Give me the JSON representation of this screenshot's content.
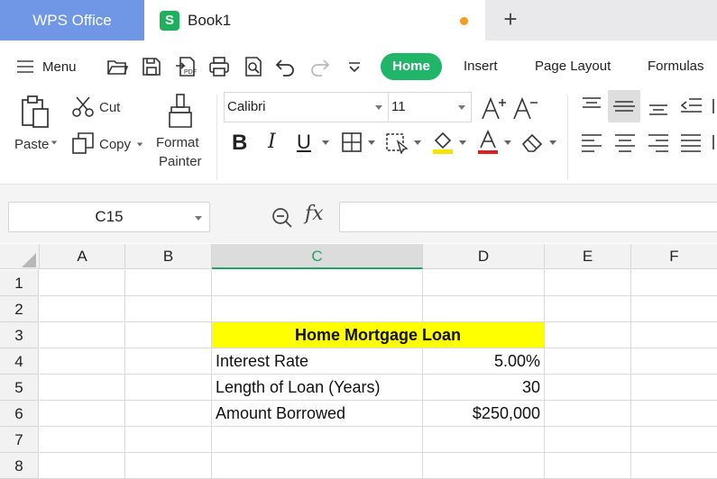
{
  "app": {
    "name": "WPS Office"
  },
  "document": {
    "title": "Book1",
    "unsaved": true
  },
  "toolbar": {
    "menu_label": "Menu",
    "quick_icons": [
      "open-folder-icon",
      "save-icon",
      "export-pdf-icon",
      "print-icon",
      "print-preview-icon",
      "undo-icon",
      "redo-icon",
      "more-dropdown-icon"
    ]
  },
  "ribbon_tabs": [
    "Home",
    "Insert",
    "Page Layout",
    "Formulas"
  ],
  "active_tab": "Home",
  "clipboard": {
    "paste_label": "Paste",
    "cut_label": "Cut",
    "copy_label": "Copy",
    "format_painter_line1": "Format",
    "format_painter_line2": "Painter"
  },
  "font": {
    "family": "Calibri",
    "size": "11",
    "color_underline": "#e02020",
    "highlight_color": "#f5e400"
  },
  "formula_bar": {
    "name_box": "C15",
    "fx_label": "fx",
    "formula": ""
  },
  "sheet": {
    "columns": [
      "A",
      "B",
      "C",
      "D",
      "E",
      "F"
    ],
    "selected_column": "C",
    "rows": [
      "1",
      "2",
      "3",
      "4",
      "5",
      "6",
      "7",
      "8"
    ],
    "header_fill": "#ffff00",
    "table": {
      "title": "Home Mortgage Loan",
      "labels": [
        "Interest Rate",
        "Length of Loan (Years)",
        "Amount Borrowed"
      ],
      "values": [
        "5.00%",
        "30",
        "$250,000"
      ]
    }
  },
  "colors": {
    "accent_green": "#21b56a",
    "wps_tab_blue": "#6f97e6",
    "unsaved_dot": "#f39c1f"
  }
}
